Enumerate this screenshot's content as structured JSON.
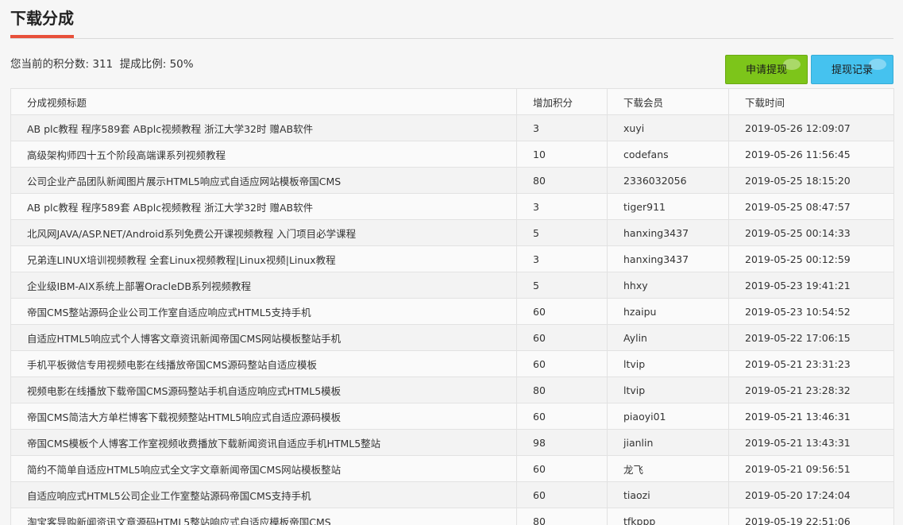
{
  "header": {
    "title": "下载分成"
  },
  "summary": {
    "points_label": "您当前的积分数:",
    "points_value": "311",
    "ratio_label": "提成比例:",
    "ratio_value": "50%"
  },
  "actions": {
    "apply_label": "申请提现",
    "records_label": "提现记录"
  },
  "colors": {
    "accent": "#e8503a",
    "apply_button": "#7dc51a",
    "records_button": "#45c2ef"
  },
  "table": {
    "columns": [
      "分成视频标题",
      "增加积分",
      "下载会员",
      "下载时间"
    ],
    "rows": [
      {
        "title": "AB plc教程 程序589套 ABplc视频教程 浙江大学32时 赠AB软件",
        "points": "3",
        "member": "xuyi",
        "time": "2019-05-26 12:09:07"
      },
      {
        "title": "高级架构师四十五个阶段高端课系列视频教程",
        "points": "10",
        "member": "codefans",
        "time": "2019-05-26 11:56:45"
      },
      {
        "title": "公司企业产品团队新闻图片展示HTML5响应式自适应网站模板帝国CMS",
        "points": "80",
        "member": "2336032056",
        "time": "2019-05-25 18:15:20"
      },
      {
        "title": "AB plc教程 程序589套 ABplc视频教程 浙江大学32时 赠AB软件",
        "points": "3",
        "member": "tiger911",
        "time": "2019-05-25 08:47:57"
      },
      {
        "title": "北风网JAVA/ASP.NET/Android系列免费公开课视频教程 入门项目必学课程",
        "points": "5",
        "member": "hanxing3437",
        "time": "2019-05-25 00:14:33"
      },
      {
        "title": "兄弟连LINUX培训视频教程 全套Linux视频教程|Linux视频|Linux教程",
        "points": "3",
        "member": "hanxing3437",
        "time": "2019-05-25 00:12:59"
      },
      {
        "title": "企业级IBM-AIX系统上部署OracleDB系列视频教程",
        "points": "5",
        "member": "hhxy",
        "time": "2019-05-23 19:41:21"
      },
      {
        "title": "帝国CMS整站源码企业公司工作室自适应响应式HTML5支持手机",
        "points": "60",
        "member": "hzaipu",
        "time": "2019-05-23 10:54:52"
      },
      {
        "title": "自适应HTML5响应式个人博客文章资讯新闻帝国CMS网站模板整站手机",
        "points": "60",
        "member": "Aylin",
        "time": "2019-05-22 17:06:15"
      },
      {
        "title": "手机平板微信专用视频电影在线播放帝国CMS源码整站自适应模板",
        "points": "60",
        "member": "ltvip",
        "time": "2019-05-21 23:31:23"
      },
      {
        "title": "视频电影在线播放下载帝国CMS源码整站手机自适应响应式HTML5模板",
        "points": "80",
        "member": "ltvip",
        "time": "2019-05-21 23:28:32"
      },
      {
        "title": "帝国CMS简洁大方单栏博客下载视频整站HTML5响应式自适应源码模板",
        "points": "60",
        "member": "piaoyi01",
        "time": "2019-05-21 13:46:31"
      },
      {
        "title": "帝国CMS模板个人博客工作室视频收费播放下载新闻资讯自适应手机HTML5整站",
        "points": "98",
        "member": "jianlin",
        "time": "2019-05-21 13:43:31"
      },
      {
        "title": "简约不简单自适应HTML5响应式全文字文章新闻帝国CMS网站模板整站",
        "points": "60",
        "member": "龙飞",
        "time": "2019-05-21 09:56:51"
      },
      {
        "title": "自适应响应式HTML5公司企业工作室整站源码帝国CMS支持手机",
        "points": "60",
        "member": "tiaozi",
        "time": "2019-05-20 17:24:04"
      },
      {
        "title": "淘宝客导购新闻资讯文章源码HTML5整站响应式自适应模板帝国CMS",
        "points": "80",
        "member": "tfkppp",
        "time": "2019-05-19 22:51:06"
      }
    ]
  }
}
